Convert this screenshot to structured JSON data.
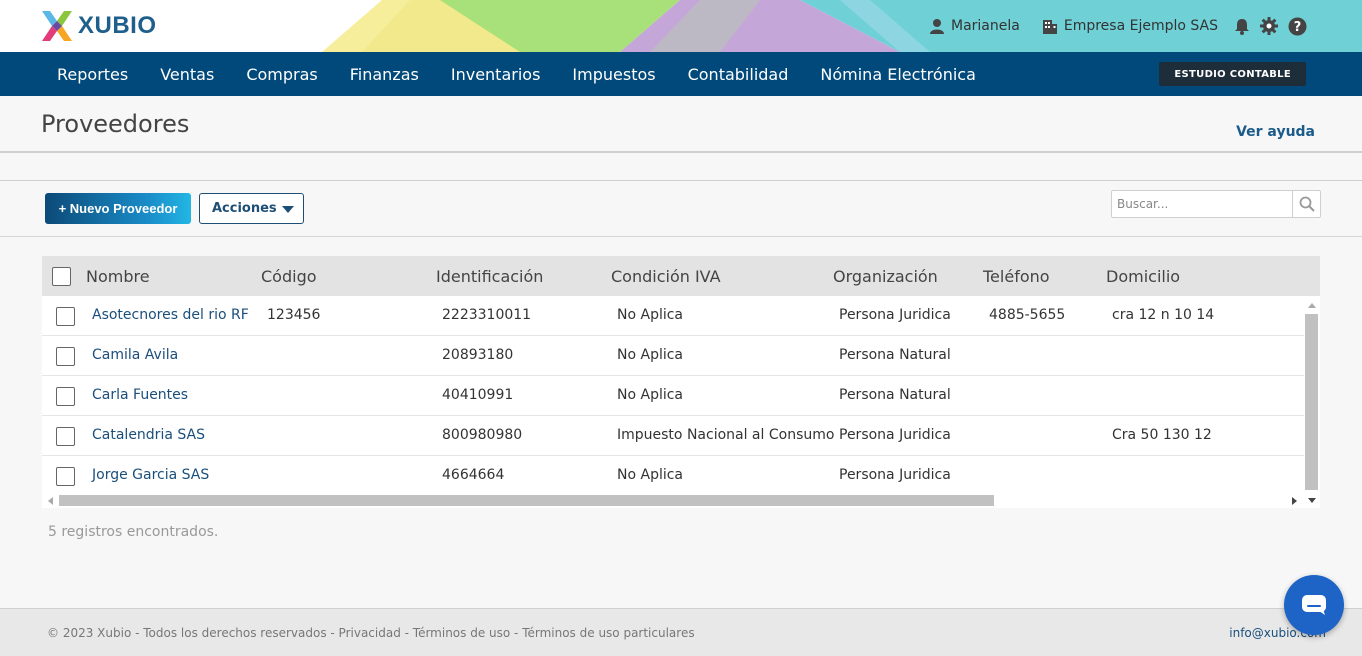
{
  "header": {
    "brand": "XUBIO",
    "user_name": "Marianela",
    "company": "Empresa Ejemplo SAS",
    "icons": [
      "user-icon",
      "building-icon",
      "bell-icon",
      "gear-icon",
      "help-icon"
    ]
  },
  "nav": {
    "items": [
      {
        "label": "Reportes"
      },
      {
        "label": "Ventas"
      },
      {
        "label": "Compras"
      },
      {
        "label": "Finanzas"
      },
      {
        "label": "Inventarios"
      },
      {
        "label": "Impuestos"
      },
      {
        "label": "Contabilidad"
      },
      {
        "label": "Nómina Electrónica"
      }
    ],
    "estudio_label": "ESTUDIO CONTABLE"
  },
  "page": {
    "title": "Proveedores",
    "help_label": "Ver ayuda"
  },
  "toolbar": {
    "new_label": "+ Nuevo Proveedor",
    "actions_label": "Acciones",
    "search_placeholder": "Buscar..."
  },
  "table": {
    "columns": [
      "Nombre",
      "Código",
      "Identificación",
      "Condición IVA",
      "Organización",
      "Teléfono",
      "Domicilio"
    ],
    "rows": [
      {
        "nombre": "Asotecnores del rio RF",
        "codigo": "123456",
        "identificacion": "2223310011",
        "condicion": "No Aplica",
        "organizacion": "Persona Juridica",
        "telefono": "4885-5655",
        "domicilio": "cra 12 n 10 14"
      },
      {
        "nombre": "Camila Avila",
        "codigo": "",
        "identificacion": "20893180",
        "condicion": "No Aplica",
        "organizacion": "Persona Natural",
        "telefono": "",
        "domicilio": ""
      },
      {
        "nombre": "Carla Fuentes",
        "codigo": "",
        "identificacion": "40410991",
        "condicion": "No Aplica",
        "organizacion": "Persona Natural",
        "telefono": "",
        "domicilio": ""
      },
      {
        "nombre": "Catalendria SAS",
        "codigo": "",
        "identificacion": "800980980",
        "condicion": "Impuesto Nacional al Consumo",
        "organizacion": "Persona Juridica",
        "telefono": "",
        "domicilio": "Cra 50 130 12"
      },
      {
        "nombre": "Jorge Garcia SAS",
        "codigo": "",
        "identificacion": "4664664",
        "condicion": "No Aplica",
        "organizacion": "Persona Juridica",
        "telefono": "",
        "domicilio": ""
      }
    ],
    "records_text": "5 registros encontrados."
  },
  "footer": {
    "copyright": "© 2023 Xubio - Todos los derechos reservados - Privacidad - Términos de uso - Términos de uso particulares",
    "email": "info@xubio.com"
  },
  "colors": {
    "nav_bg": "#00497a",
    "accent": "#1a8cc8",
    "link": "#1a4f7c",
    "chat": "#1e63c6"
  }
}
